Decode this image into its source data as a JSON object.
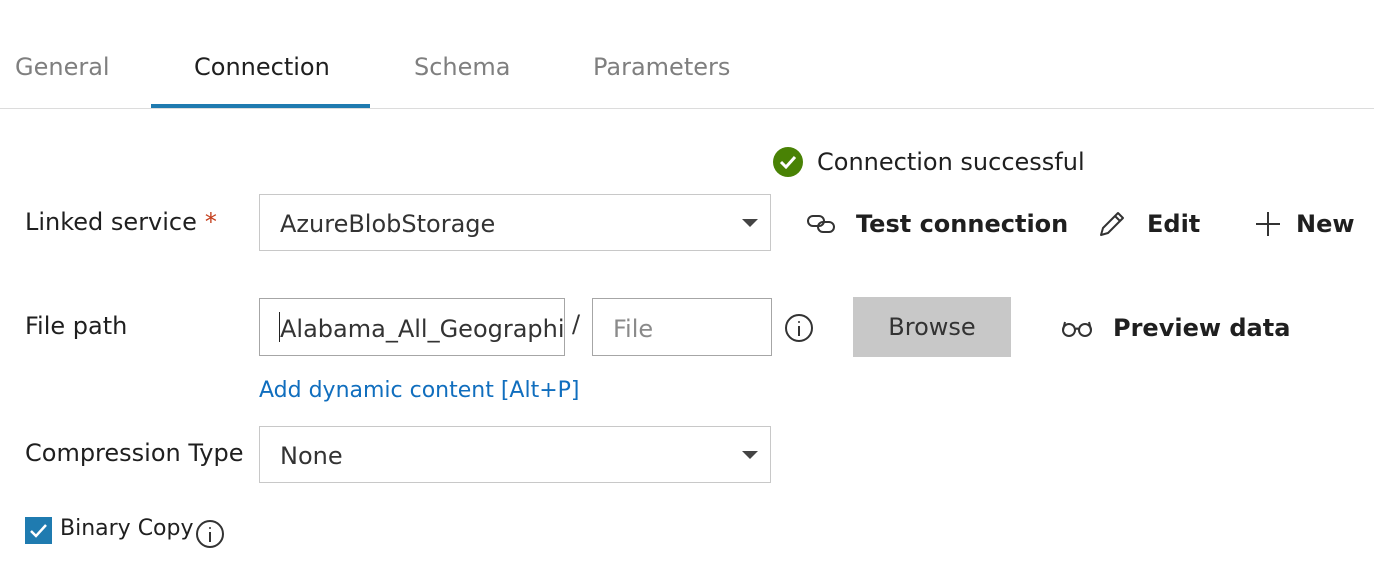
{
  "tabs": [
    {
      "label": "General",
      "active": false
    },
    {
      "label": "Connection",
      "active": true
    },
    {
      "label": "Schema",
      "active": false
    },
    {
      "label": "Parameters",
      "active": false
    }
  ],
  "status": {
    "text": "Connection successful",
    "icon": "check-circle-icon",
    "color": "#498205"
  },
  "linked_service": {
    "label": "Linked service",
    "required_mark": "*",
    "value": "AzureBlobStorage",
    "actions": {
      "test_connection": "Test connection",
      "edit": "Edit",
      "new": "New"
    }
  },
  "file_path": {
    "label": "File path",
    "folder_value": "Alabama_All_Geographi",
    "separator": "/",
    "file_placeholder": "File",
    "browse_label": "Browse",
    "preview_label": "Preview data",
    "dynamic_link": "Add dynamic content [Alt+P]"
  },
  "compression": {
    "label": "Compression Type",
    "value": "None"
  },
  "binary_copy": {
    "label": "Binary Copy",
    "checked": true
  },
  "colors": {
    "accent": "#1f7bb0",
    "link": "#106ebe",
    "required": "#c43e1c",
    "success": "#498205"
  }
}
